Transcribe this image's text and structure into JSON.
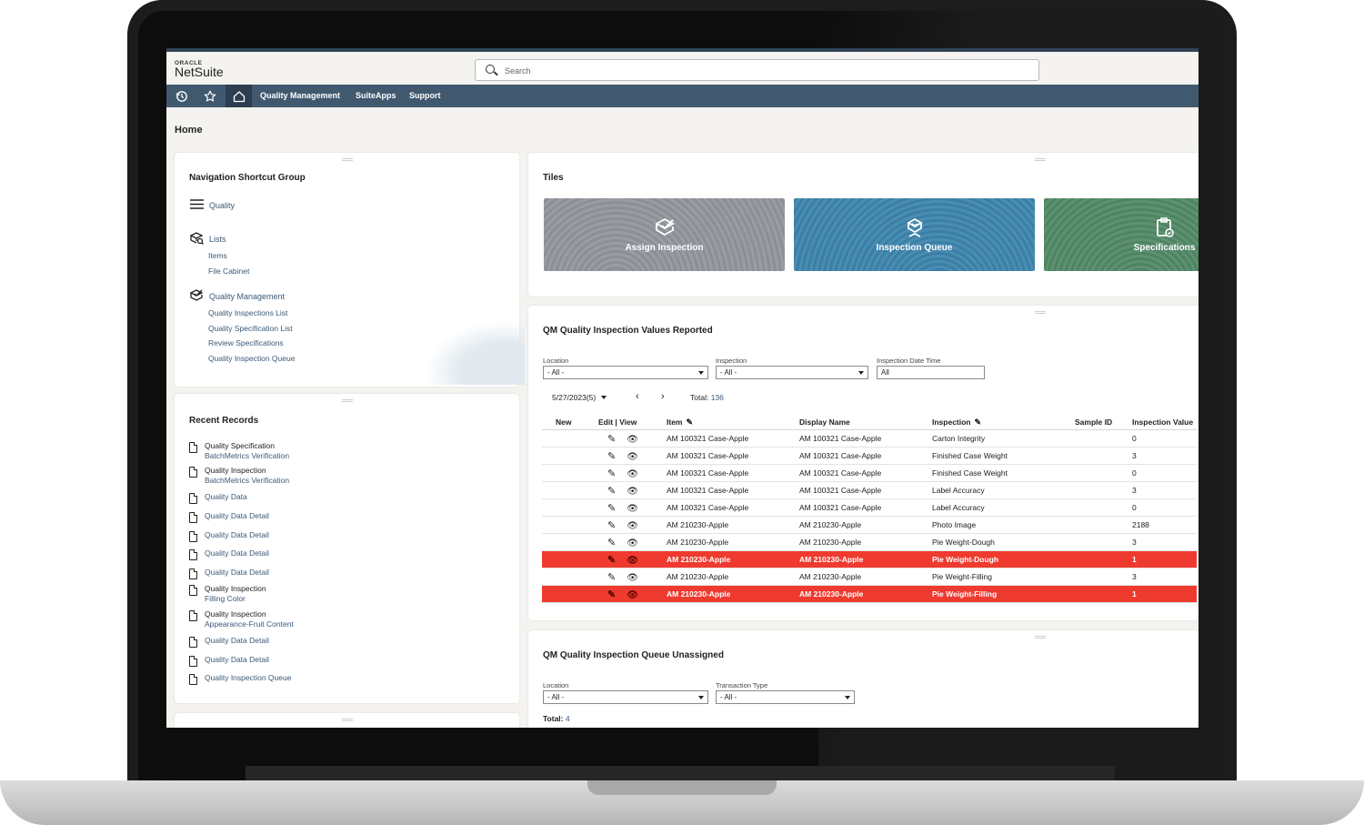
{
  "app": {
    "logo_top": "ORACLE",
    "logo_main": "NetSuite"
  },
  "search": {
    "placeholder": "Search"
  },
  "navbar": {
    "icons": [
      "history-icon",
      "star-icon",
      "home-icon"
    ],
    "links": [
      "Quality Management",
      "SuiteApps",
      "Support"
    ]
  },
  "page": {
    "title": "Home"
  },
  "shortcuts": {
    "title": "Navigation Shortcut Group",
    "menu_label": "Quality",
    "groups": [
      {
        "label": "Lists",
        "icon": "lists-icon",
        "items": [
          "Items",
          "File Cabinet"
        ]
      },
      {
        "label": "Quality Management",
        "icon": "quality-check-icon",
        "items": [
          "Quality Inspections List",
          "Quality Specification List",
          "Review Specifications",
          "Quality Inspection Queue"
        ]
      }
    ]
  },
  "recent": {
    "title": "Recent Records",
    "items": [
      {
        "title": "Quality Specification",
        "sub": "BatchMetrics Verification"
      },
      {
        "title": "Quality Inspection",
        "sub": "BatchMetrics Verification"
      },
      {
        "link": "Quality Data"
      },
      {
        "link": "Quality Data Detail"
      },
      {
        "link": "Quality Data Detail"
      },
      {
        "link": "Quality Data Detail"
      },
      {
        "link": "Quality Data Detail"
      },
      {
        "title": "Quality Inspection",
        "sub": "Filling Color"
      },
      {
        "title": "Quality Inspection",
        "sub": "Appearance-Fruit Content"
      },
      {
        "link": "Quality Data Detail"
      },
      {
        "link": "Quality Data Detail"
      },
      {
        "link": "Quality Inspection Queue"
      }
    ]
  },
  "tiles": {
    "title": "Tiles",
    "items": [
      {
        "label": "Assign Inspection",
        "icon": "assign-inspection-icon",
        "color": "#939599"
      },
      {
        "label": "Inspection Queue",
        "icon": "inspection-queue-icon",
        "color": "#4487ad"
      },
      {
        "label": "Specifications",
        "icon": "specifications-icon",
        "color": "#578b6a"
      }
    ]
  },
  "values_report": {
    "title": "QM Quality Inspection Values Reported",
    "filters": {
      "location_label": "Location",
      "location_value": "- All -",
      "inspection_label": "Inspection",
      "inspection_value": "- All -",
      "datetime_label": "Inspection Date Time",
      "datetime_value": "All"
    },
    "pager": {
      "page_select": "5/27/2023(5)",
      "total_label": "Total:",
      "total_value": "136"
    },
    "columns": [
      "New",
      "Edit | View",
      "Item",
      "Display Name",
      "Inspection",
      "Sample ID",
      "Inspection Value"
    ],
    "rows": [
      {
        "item": "AM 100321 Case-Apple",
        "display": "AM 100321 Case-Apple",
        "inspection": "Carton Integrity",
        "sample": "",
        "value": "0",
        "alert": false
      },
      {
        "item": "AM 100321 Case-Apple",
        "display": "AM 100321 Case-Apple",
        "inspection": "Finished Case Weight",
        "sample": "",
        "value": "3",
        "alert": false
      },
      {
        "item": "AM 100321 Case-Apple",
        "display": "AM 100321 Case-Apple",
        "inspection": "Finished Case Weight",
        "sample": "",
        "value": "0",
        "alert": false
      },
      {
        "item": "AM 100321 Case-Apple",
        "display": "AM 100321 Case-Apple",
        "inspection": "Label Accuracy",
        "sample": "",
        "value": "3",
        "alert": false
      },
      {
        "item": "AM 100321 Case-Apple",
        "display": "AM 100321 Case-Apple",
        "inspection": "Label Accuracy",
        "sample": "",
        "value": "0",
        "alert": false
      },
      {
        "item": "AM 210230-Apple",
        "display": "AM 210230-Apple",
        "inspection": "Photo Image",
        "sample": "",
        "value": "2188",
        "alert": false
      },
      {
        "item": "AM 210230-Apple",
        "display": "AM 210230-Apple",
        "inspection": "Pie Weight-Dough",
        "sample": "",
        "value": "3",
        "alert": false
      },
      {
        "item": "AM 210230-Apple",
        "display": "AM 210230-Apple",
        "inspection": "Pie Weight-Dough",
        "sample": "",
        "value": "1",
        "alert": true
      },
      {
        "item": "AM 210230-Apple",
        "display": "AM 210230-Apple",
        "inspection": "Pie Weight-Filling",
        "sample": "",
        "value": "3",
        "alert": false
      },
      {
        "item": "AM 210230-Apple",
        "display": "AM 210230-Apple",
        "inspection": "Pie Weight-Filling",
        "sample": "",
        "value": "1",
        "alert": true
      }
    ],
    "alert_color": "#ef3a2f"
  },
  "queue_unassigned": {
    "title": "QM Quality Inspection Queue Unassigned",
    "filters": {
      "location_label": "Location",
      "location_value": "- All -",
      "type_label": "Transaction Type",
      "type_value": "- All -"
    },
    "total_label": "Total:",
    "total_value": "4"
  },
  "colors": {
    "navbar": "#41596f",
    "link": "#3a5a78"
  }
}
